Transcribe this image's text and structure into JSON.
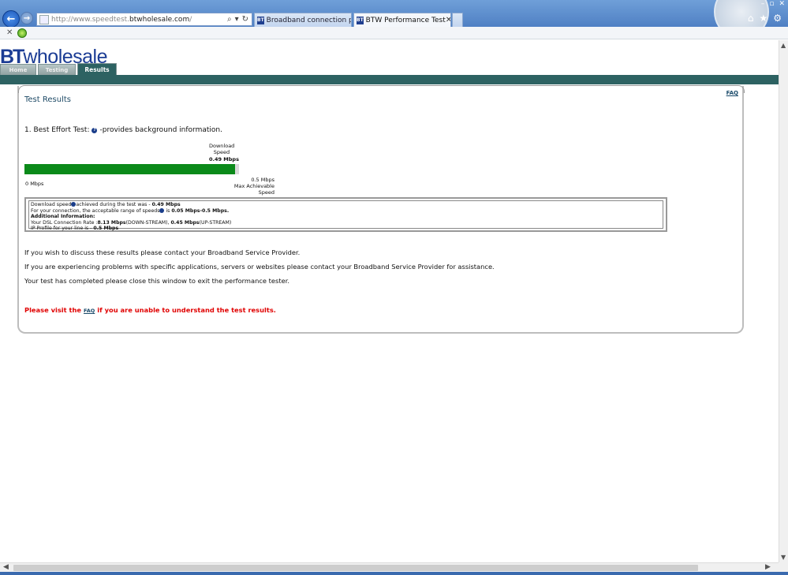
{
  "browser": {
    "url_prefix": "http://www.speedtest.",
    "url_domain": "btwholesale.com",
    "url_suffix": "/",
    "tabs": [
      {
        "label": "Broadband connection proble...",
        "favicon": "BT"
      },
      {
        "label": "BTW Performance Test",
        "favicon": "BT"
      }
    ],
    "search_icon": "⌕",
    "dropdown_icon": "▾",
    "refresh_icon": "↻",
    "close_icon": "✕",
    "home_icon": "⌂",
    "favorites_icon": "★",
    "tools_icon": "⚙",
    "back_icon": "←",
    "forward_icon": "→",
    "stop_icon": "✕",
    "window_min": "–",
    "window_max": "▫",
    "window_close": "✕"
  },
  "site": {
    "logo_bt": "BT",
    "logo_wholesale": "wholesale",
    "nav": [
      "Home",
      "Testing",
      "Results"
    ],
    "brand_color": "#1b3c94",
    "nav_color": "#2d6262"
  },
  "results": {
    "title": "Test Results",
    "faq_link": "FAQ",
    "test_heading": "1. Best Effort Test:",
    "test_heading_note": "-provides background information.",
    "download_label": "Download Speed",
    "download_value": "0.49 Mbps",
    "progress": {
      "value": 0.49,
      "max": 0.5,
      "fill_color": "#0b8a1a"
    },
    "min_label": "0 Mbps",
    "max_value_label": "0.5 Mbps",
    "max_caption": "Max Achievable Speed",
    "info": {
      "line1_a": "Download speed",
      "line1_b": "achieved during the test was - ",
      "line1_value": "0.49 Mbps",
      "line2_a": "For your connection, the acceptable range of speeds",
      "line2_b": " is ",
      "line2_value": "0.05 Mbps-0.5 Mbps.",
      "line3": "Additional Information:",
      "line4_a": "Your DSL Connection Rate :",
      "line4_down": "8.13 Mbps",
      "line4_b": "(DOWN-STREAM), ",
      "line4_up": "0.45 Mbps",
      "line4_c": "(UP-STREAM)",
      "line5_a": "IP Profile for your line is - ",
      "line5_value": "0.5 Mbps"
    },
    "para1": "If you wish to discuss these results please contact your Broadband Service Provider.",
    "para2": "If you are experiencing problems with specific applications, servers or websites please contact your Broadband Service Provider for assistance.",
    "para3": "Your test has completed please close this window to exit the performance tester.",
    "red_note_a": "Please visit the",
    "red_note_link": "FAQ",
    "red_note_b": "if you are unable to understand the test results."
  }
}
